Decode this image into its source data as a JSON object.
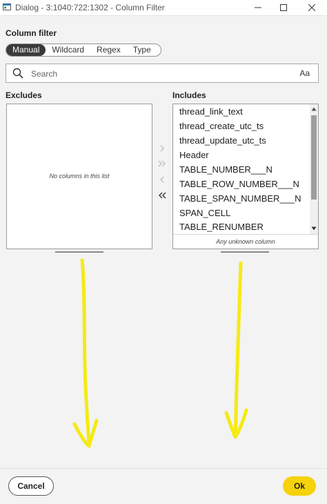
{
  "window": {
    "title": "Dialog - 3:1040:722:1302 - Column Filter",
    "icon": "window-app-icon"
  },
  "column_filter": {
    "label": "Column filter",
    "modes": [
      {
        "label": "Manual",
        "active": true
      },
      {
        "label": "Wildcard",
        "active": false
      },
      {
        "label": "Regex",
        "active": false
      },
      {
        "label": "Type",
        "active": false
      }
    ]
  },
  "search": {
    "placeholder": "Search",
    "value": "",
    "case_toggle": "Aa"
  },
  "excludes": {
    "label": "Excludes",
    "empty_message": "No columns in this list",
    "items": []
  },
  "includes": {
    "label": "Includes",
    "items": [
      "thread_link_text",
      "thread_create_utc_ts",
      "thread_update_utc_ts",
      "Header",
      "TABLE_NUMBER___N",
      "TABLE_ROW_NUMBER___N",
      "TABLE_SPAN_NUMBER___N",
      "SPAN_CELL",
      "TABLE_RENUMBER"
    ],
    "footer": "Any unknown column"
  },
  "buttons": {
    "cancel": "Cancel",
    "ok": "Ok"
  },
  "colors": {
    "accent": "#f5d20b",
    "annotation": "#f5ea14",
    "active_segment": "#3a3a3a"
  }
}
